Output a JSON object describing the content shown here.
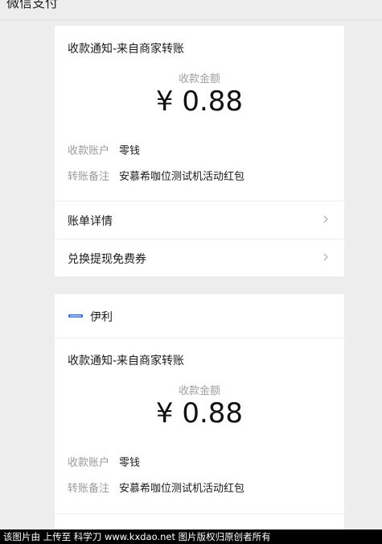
{
  "topbar": {
    "title": "微信支付"
  },
  "cards": [
    {
      "notice_title": "收款通知-来自商家转账",
      "amount_label": "收款金额",
      "amount_value": "¥ 0.88",
      "account_key": "收款账户",
      "account_value": "零钱",
      "remark_key": "转账备注",
      "remark_value": "安慕希咖位测试机活动红包",
      "bill_detail_label": "账单详情",
      "coupon_label": "兑换提现免费券"
    },
    {
      "merchant_name": "伊利",
      "notice_title": "收款通知-来自商家转账",
      "amount_label": "收款金额",
      "amount_value": "¥ 0.88",
      "account_key": "收款账户",
      "account_value": "零钱",
      "remark_key": "转账备注",
      "remark_value": "安慕希咖位测试机活动红包"
    }
  ],
  "watermark": {
    "text": "该图片由  上传至  科学刀  www.kxdao.net  图片版权归原创者所有"
  },
  "colors": {
    "background": "#ededed",
    "card": "#ffffff",
    "muted_text": "#9a9a9a",
    "text": "#1a1a1a"
  }
}
